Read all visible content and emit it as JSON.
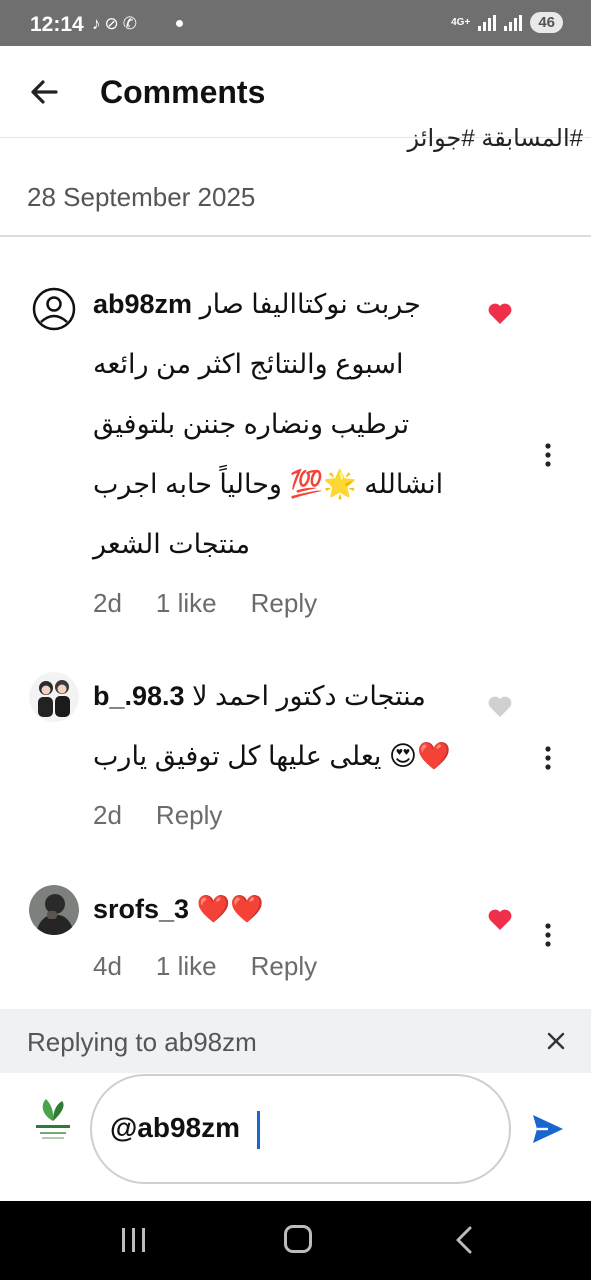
{
  "status_bar": {
    "time": "12:14",
    "network": "4G+",
    "battery": "46"
  },
  "header": {
    "title": "Comments"
  },
  "post": {
    "caption_tail": "#المسابقة #جوائز",
    "date": "28 September 2025"
  },
  "comments": [
    {
      "username": "ab98zm",
      "lines": [
        "جربت نوكتااليفا صار",
        "اسبوع والنتائج اكثر من رائعه",
        "ترطيب ونضاره جننن بلتوفيق",
        "انشالله 🌟💯 وحالياً حابه اجرب",
        "منتجات الشعر"
      ],
      "time": "2d",
      "likes": "1 like",
      "reply_label": "Reply",
      "liked": true
    },
    {
      "username": "b_.98.3",
      "lines": [
        "منتجات دكتور احمد لا",
        "يعلى عليها كل توفيق يارب 😍❤️"
      ],
      "time": "2d",
      "likes": "",
      "reply_label": "Reply",
      "liked": false
    },
    {
      "username": "srofs_3",
      "lines": [
        "❤️❤️"
      ],
      "time": "4d",
      "likes": "1 like",
      "reply_label": "Reply",
      "liked": true
    }
  ],
  "reply_bar": {
    "text": "Replying to ab98zm"
  },
  "composer": {
    "value": "@ab98zm"
  },
  "colors": {
    "heart_liked": "#f0304a",
    "heart_unliked": "#d0d0d0",
    "accent": "#1a66d1"
  }
}
